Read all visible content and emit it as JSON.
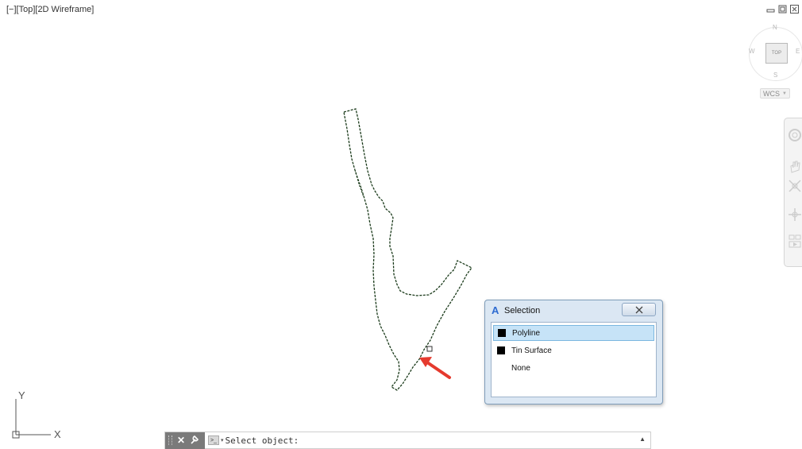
{
  "viewport": {
    "label": "[−][Top][2D Wireframe]"
  },
  "window_controls": [
    "minimize-icon",
    "restore-icon",
    "close-icon"
  ],
  "viewcube": {
    "top": "TOP",
    "north": "N",
    "south": "S",
    "east": "E",
    "west": "W"
  },
  "wcs": {
    "label": "WCS"
  },
  "ucs": {
    "x_label": "X",
    "y_label": "Y"
  },
  "selection_dialog": {
    "title": "Selection",
    "items": [
      {
        "label": "Polyline",
        "selected": true,
        "swatch": "#000000"
      },
      {
        "label": "Tin Surface",
        "selected": false,
        "swatch": "#000000"
      },
      {
        "label": "None",
        "selected": false,
        "swatch": ""
      }
    ]
  },
  "command_line": {
    "prompt": "Select object:"
  },
  "colors": {
    "polyline": "#1a3a1a",
    "arrow": "#e53a2e",
    "dialog_frame": "#dbe7f3"
  }
}
